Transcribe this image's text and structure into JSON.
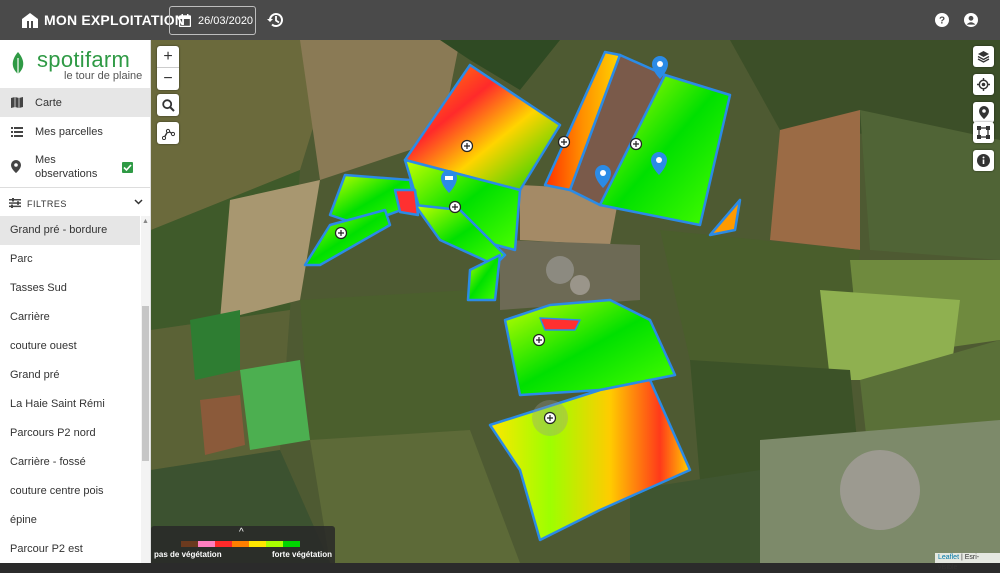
{
  "topbar": {
    "title": "MON EXPLOITATION",
    "date": "26/03/2020",
    "farm_icon": "farm-icon",
    "calendar_icon": "calendar-icon",
    "history_icon": "history-icon",
    "help_icon": "help-icon",
    "user_icon": "user-icon"
  },
  "logo": {
    "name": "spotifarm",
    "tagline": "le tour de plaine",
    "brand_color": "#2f9a45"
  },
  "nav": {
    "carte": "Carte",
    "parcelles": "Mes parcelles",
    "observations_line1": "Mes",
    "observations_line2": "observations",
    "observations_checked": true
  },
  "filters": {
    "label": "FILTRES"
  },
  "parcels": [
    "Grand pré - bordure",
    "Parc",
    "Tasses Sud",
    "Carrière",
    "couture ouest",
    "Grand pré",
    "La Haie Saint Rémi",
    "Parcours P2 nord",
    "Carrière - fossé",
    "couture centre pois",
    "épine",
    "Parcour P2 est"
  ],
  "active_parcel": "Grand pré - bordure",
  "map_controls": {
    "zoom_in": "+",
    "zoom_out": "−",
    "search": "search-icon",
    "draw": "draw-line-icon",
    "layers": "layers-icon",
    "locate": "locate-icon",
    "marker": "marker-icon",
    "select_area": "select-area-icon",
    "info": "info-icon"
  },
  "legend": {
    "min_label": "pas de végétation",
    "max_label": "forte végétation",
    "colors": [
      "#6b3a1e",
      "#ff7fbf",
      "#ff2a2a",
      "#ff7f00",
      "#ffe600",
      "#a8ff00",
      "#00d400"
    ]
  },
  "attribution": {
    "leaflet": "Leaflet",
    "sep": " | ",
    "source": "Esri-visible"
  },
  "field_outline_color": "#2b8be6"
}
